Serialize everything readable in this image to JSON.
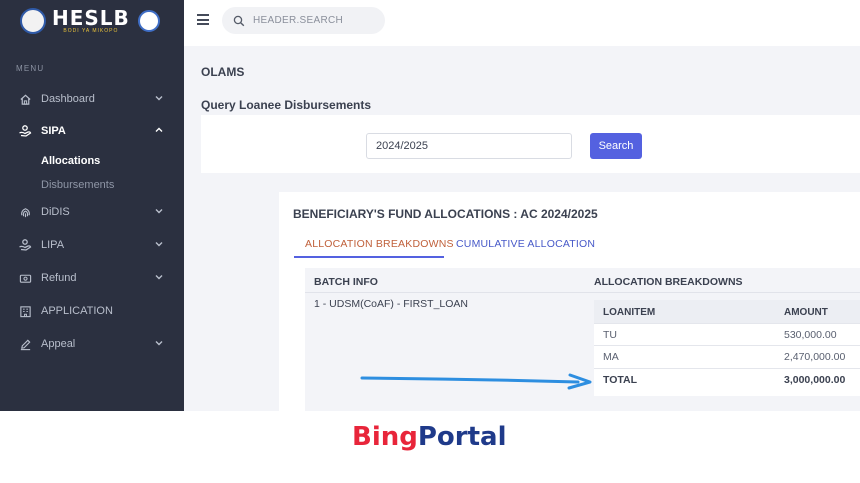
{
  "brand": {
    "name": "HESLB",
    "tagline": "BODI YA MIKOPO"
  },
  "sidebar": {
    "menu_title": "MENU",
    "items": [
      {
        "label": "Dashboard",
        "icon": "home-icon",
        "expanded": false
      },
      {
        "label": "SIPA",
        "icon": "hand-coin-icon",
        "expanded": true,
        "children": [
          {
            "label": "Allocations",
            "active": true
          },
          {
            "label": "Disbursements",
            "active": false
          }
        ]
      },
      {
        "label": "DiDIS",
        "icon": "fingerprint-icon",
        "expanded": false
      },
      {
        "label": "LIPA",
        "icon": "hand-coin-icon",
        "expanded": false
      },
      {
        "label": "Refund",
        "icon": "refund-icon",
        "expanded": false
      },
      {
        "label": "APPLICATION",
        "icon": "building-icon"
      },
      {
        "label": "Appeal",
        "icon": "pen-icon",
        "expanded": false
      }
    ]
  },
  "header": {
    "search_placeholder": "HEADER.SEARCH"
  },
  "page": {
    "section_title": "OLAMS",
    "query_title": "Query Loanee Disbursements",
    "year_value": "2024/2025",
    "search_button": "Search"
  },
  "allocations": {
    "title": "BENEFICIARY'S FUND ALLOCATIONS : AC 2024/2025",
    "tabs": [
      {
        "label": "ALLOCATION BREAKDOWNS",
        "active": true
      },
      {
        "label": "CUMULATIVE ALLOCATION",
        "active": false
      }
    ],
    "columns": [
      "BATCH INFO",
      "ALLOCATION BREAKDOWNS"
    ],
    "batch": "1 - UDSM(CoAF) - FIRST_LOAN",
    "breakdown_columns": [
      "LOANITEM",
      "AMOUNT"
    ],
    "rows": [
      {
        "item": "TU",
        "amount": "530,000.00"
      },
      {
        "item": "MA",
        "amount": "2,470,000.00"
      }
    ],
    "total": {
      "item": "TOTAL",
      "amount": "3,000,000.00"
    }
  },
  "watermark": {
    "part1": "Bing",
    "part2": "Portal"
  },
  "colors": {
    "sidebar": "#2b3040",
    "primary": "#5461e0",
    "tab_active": "#c0603a",
    "arrow": "#2d8ee0"
  }
}
